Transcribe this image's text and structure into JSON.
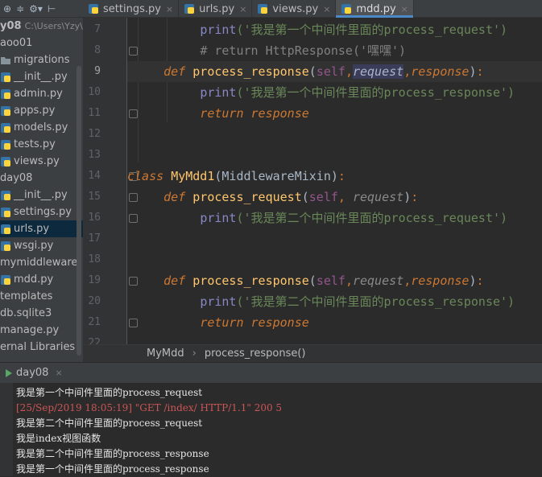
{
  "toolbar": {
    "icons": [
      "globe-icon",
      "collapse-icon",
      "settings-icon",
      "hide-icon"
    ]
  },
  "tabs": [
    {
      "label": "settings.py",
      "active": false
    },
    {
      "label": "urls.py",
      "active": false
    },
    {
      "label": "views.py",
      "active": false
    },
    {
      "label": "mdd.py",
      "active": true
    }
  ],
  "tab_close": "×",
  "sidebar": {
    "items": [
      {
        "label": "y08",
        "hint": "C:\\Users\\Yzy\\",
        "type": "root"
      },
      {
        "label": "aoo01",
        "type": "folder"
      },
      {
        "label": "migrations",
        "type": "folder"
      },
      {
        "label": "__init__.py",
        "type": "py"
      },
      {
        "label": "admin.py",
        "type": "py"
      },
      {
        "label": "apps.py",
        "type": "py"
      },
      {
        "label": "models.py",
        "type": "py"
      },
      {
        "label": "tests.py",
        "type": "py"
      },
      {
        "label": "views.py",
        "type": "py"
      },
      {
        "label": "day08",
        "type": "folder"
      },
      {
        "label": "__init__.py",
        "type": "py"
      },
      {
        "label": "settings.py",
        "type": "py"
      },
      {
        "label": "urls.py",
        "type": "py",
        "selected": true
      },
      {
        "label": "wsgi.py",
        "type": "py"
      },
      {
        "label": "mymiddleware",
        "type": "folder"
      },
      {
        "label": "mdd.py",
        "type": "py"
      },
      {
        "label": "templates",
        "type": "folder"
      },
      {
        "label": "db.sqlite3",
        "type": "db"
      },
      {
        "label": "manage.py",
        "type": "py"
      },
      {
        "label": "ernal Libraries",
        "type": "lib"
      }
    ]
  },
  "editor": {
    "line_numbers": [
      "7",
      "8",
      "9",
      "10",
      "11",
      "12",
      "13",
      "14",
      "15",
      "16",
      "17",
      "18",
      "19",
      "20",
      "21",
      "22"
    ],
    "current_line": "9",
    "code": {
      "l7_print": "print",
      "l7_str": "('我是第一个中间件里面的process_request')",
      "l8_comment": "# return HttpResponse('嘿嘿')",
      "l9_def": "def",
      "l9_fn": "process_response",
      "l9_self": "self",
      "l9_req": "request",
      "l9_resp": "response",
      "l10_print": "print",
      "l10_str": "('我是第一个中间件里面的process_response')",
      "l11_return": "return",
      "l11_resp": "response",
      "l14_class": "class",
      "l14_name": "MyMdd1",
      "l14_base": "(MiddlewareMixin)",
      "l15_def": "def",
      "l15_fn": "process_request",
      "l15_self": "self",
      "l15_req": "request",
      "l16_print": "print",
      "l16_str": "('我是第二个中间件里面的process_request')",
      "l19_def": "def",
      "l19_fn": "process_response",
      "l19_self": "self",
      "l19_req": "request",
      "l19_resp": "response",
      "l20_print": "print",
      "l20_str": "('我是第二个中间件里面的process_response')",
      "l21_return": "return",
      "l21_resp": "response"
    }
  },
  "breadcrumb": {
    "class": "MyMdd",
    "separator": "›",
    "method": "process_response()"
  },
  "run": {
    "label": "day08",
    "close": "×",
    "output": [
      {
        "text": "我是第一个中间件里面的process_request",
        "error": false
      },
      {
        "text": "[25/Sep/2019 18:05:19] \"GET /index/ HTTP/1.1\" 200 5",
        "error": true
      },
      {
        "text": "我是第二个中间件里面的process_request",
        "error": false
      },
      {
        "text": "我是index视图函数",
        "error": false
      },
      {
        "text": "我是第二个中间件里面的process_response",
        "error": false
      },
      {
        "text": "我是第一个中间件里面的process_response",
        "error": false
      }
    ]
  }
}
